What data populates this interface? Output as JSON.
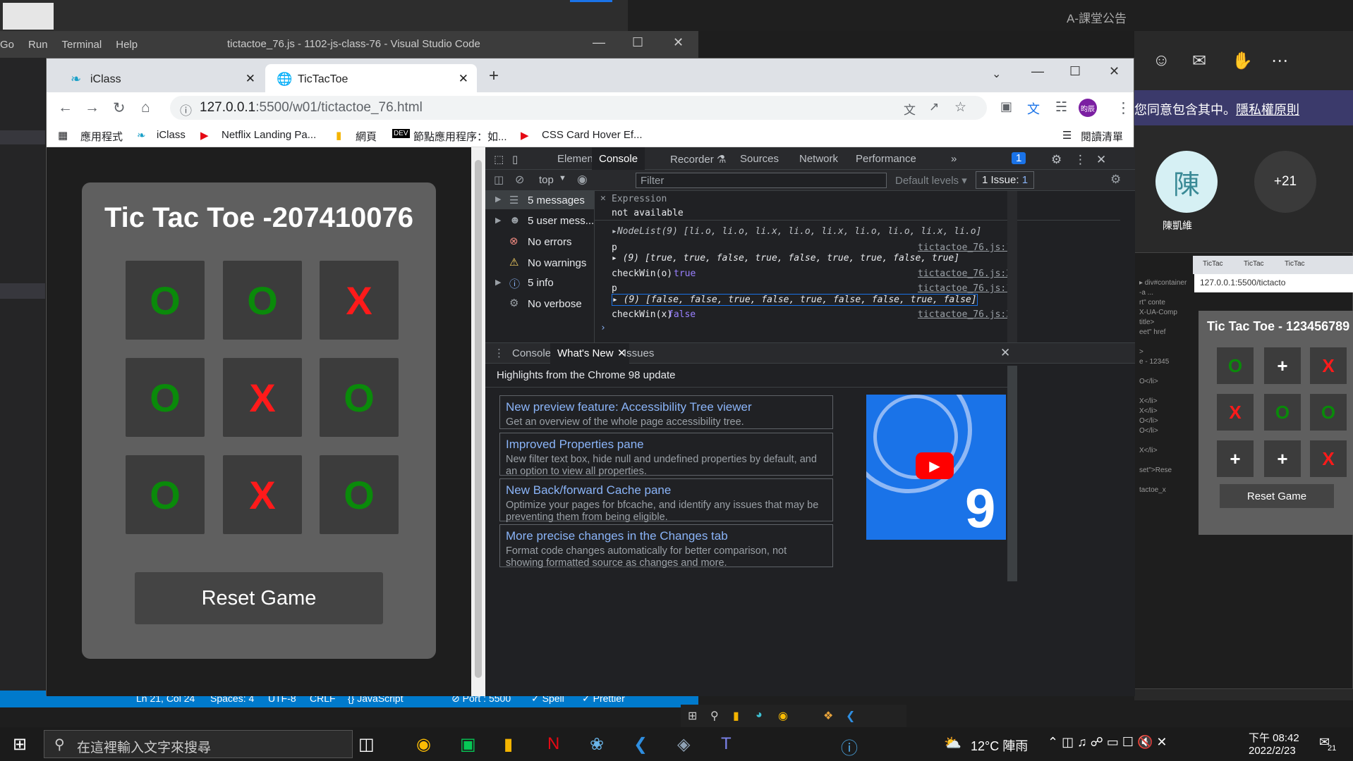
{
  "vscode": {
    "menu": [
      "Go",
      "Run",
      "Terminal",
      "Help"
    ],
    "title": "tictactoe_76.js - 1102-js-class-76 - Visual Studio Code",
    "status": [
      "Ln 21, Col 24",
      "Spaces: 4",
      "UTF-8",
      "CRLF",
      "{} JavaScript",
      "⊘ Port : 5500",
      "✓ Spell",
      "✓ Prettier"
    ]
  },
  "teams": {
    "title": "A-課堂公告",
    "banner_text": "您同意包含其中。",
    "banner_link": "隱私權原則",
    "avatar1": "陳",
    "avatar1_name": "陳凱維",
    "avatar2": "+21"
  },
  "mini": {
    "tabs": [
      "TicTac",
      "TicTac",
      "TicTac"
    ],
    "address": "127.0.0.1:5500/tictacto",
    "code": [
      "▸ div#container",
      "-a ...",
      "rt\" conte",
      "X-UA-Comp",
      "title>",
      "eet\" href",
      "",
      ">",
      "e - 12345",
      "",
      "O</li>",
      "",
      "X</li>",
      "X</li>",
      "O</li>",
      "O</li>",
      "",
      "X</li>",
      "",
      "set\">Rese",
      "",
      "tactoe_x"
    ],
    "title": "Tic Tac Toe - 123456789",
    "cells": [
      "O",
      "+",
      "X",
      "X",
      "O",
      "O",
      "+",
      "+",
      "X"
    ],
    "reset": "Reset Game"
  },
  "chrome": {
    "tabs": [
      {
        "label": "iClass"
      },
      {
        "label": "TicTacToe"
      }
    ],
    "url_host": "127.0.0.1",
    "url_rest": ":5500/w01/tictactoe_76.html",
    "profile": "昀辰",
    "bookmarks": [
      "應用程式",
      "iClass",
      "Netflix Landing Pa...",
      "網頁",
      "節點應用程序：如...",
      "CSS Card Hover Ef...",
      "閱讀清單"
    ]
  },
  "game": {
    "title": "Tic Tac Toe -207410076",
    "cells": [
      "O",
      "O",
      "X",
      "O",
      "X",
      "O",
      "O",
      "X",
      "O"
    ],
    "reset": "Reset Game"
  },
  "devtools": {
    "tabs": [
      "Elements",
      "Console",
      "Recorder ⚗",
      "Sources",
      "Network",
      "Performance",
      "»"
    ],
    "issues_badge": "1",
    "context": "top",
    "filter_placeholder": "Filter",
    "levels": "Default levels ▾",
    "issue_count": "1 Issue:",
    "issue_num": "1",
    "sidebar": [
      "5 messages",
      "5 user mess...",
      "No errors",
      "No warnings",
      "5 info",
      "No verbose"
    ],
    "expression_label": "Expression",
    "expression_value": "not available",
    "log": [
      {
        "text": "▸NodeList(9) [li.o, li.o, li.x, li.o, li.x, li.o, li.o, li.x, li.o]",
        "src": ""
      },
      {
        "text": "p",
        "src": "tictactoe_76.js:13"
      },
      {
        "text": "▸ (9) [true, true, false, true, false, true, true, false, true]",
        "src": ""
      },
      {
        "text": "checkWin(o)",
        "val": "true",
        "src": "tictactoe_76.js:29"
      },
      {
        "text": "p",
        "src": "tictactoe_76.js:13"
      },
      {
        "text": "▸ (9) [false, false, true, false, true, false, false, true, false]",
        "src": ""
      },
      {
        "text": "checkWin(x)",
        "val": "false",
        "src": "tictactoe_76.js:30"
      }
    ],
    "drawer_tabs": [
      "Console",
      "What's New",
      "Issues"
    ],
    "whats_new_head": "Highlights from the Chrome 98 update",
    "cards": [
      {
        "title": "New preview feature: Accessibility Tree viewer",
        "desc": "Get an overview of the whole page accessibility tree."
      },
      {
        "title": "Improved Properties pane",
        "desc": "New filter text box, hide null and undefined properties by default, and an option to view all properties."
      },
      {
        "title": "New Back/forward Cache pane",
        "desc": "Optimize your pages for bfcache, and identify any issues that may be preventing them from being eligible."
      },
      {
        "title": "More precise changes in the Changes tab",
        "desc": "Format code changes automatically for better comparison, not showing formatted source as changes and more."
      }
    ]
  },
  "taskbar": {
    "search_placeholder": "在這裡輸入文字來搜尋",
    "weather": "12°C 陣雨",
    "time": "下午 08:42",
    "date": "2022/2/23",
    "notif": "21"
  },
  "colors": {
    "o": "#0a8a0a",
    "x": "#ff1a1a",
    "accent": "#8ab4f8"
  }
}
